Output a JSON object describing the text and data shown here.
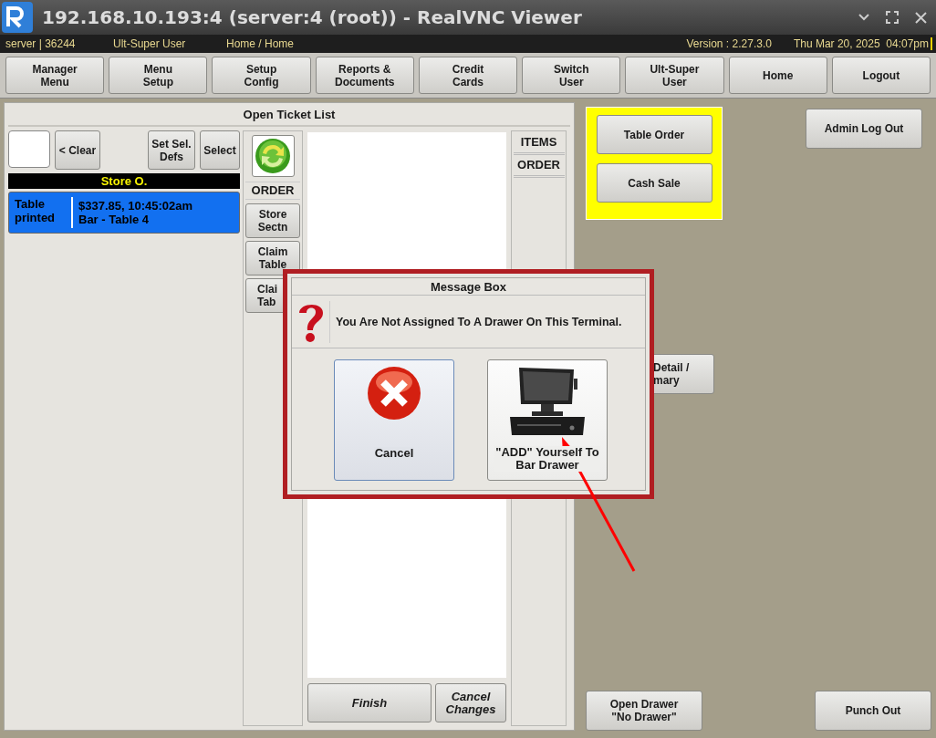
{
  "window": {
    "title": "192.168.10.193:4 (server:4 (root)) - RealVNC Viewer"
  },
  "status_bar": {
    "user": "server | 36244",
    "role": "Ult-Super User",
    "path": "Home / Home",
    "version": "Version : 2.27.3.0",
    "datetime": "Thu Mar 20, 2025  04:07pm"
  },
  "toolbar": [
    "Manager\nMenu",
    "Menu\nSetup",
    "Setup\nConfig",
    "Reports &\nDocuments",
    "Credit\nCards",
    "Switch\nUser",
    "Ult-Super\nUser",
    "Home",
    "Logout"
  ],
  "open_ticket_list": {
    "title": "Open Ticket List",
    "clear_button": "< Clear",
    "set_defaults_button": "Set Sel.\nDefs",
    "select_button": "Select",
    "section": "Store O.",
    "tickets": [
      {
        "status": "Table\nprinted",
        "summary": "$337.85, 10:45:02am",
        "location": "Bar - Table 4",
        "selected": true
      }
    ],
    "order_column": {
      "header": "ORDER",
      "buttons": [
        "Store\nSectn",
        "Claim\nTable",
        "Clai\nTab"
      ]
    },
    "items_tabs": [
      "ITEMS",
      "ORDER"
    ],
    "finish_button": "Finish",
    "cancel_changes_button": "Cancel\nChanges"
  },
  "right_panel": {
    "order_types": [
      "Table Order",
      "Cash Sale"
    ],
    "admin_button": "Admin Log Out",
    "detail_button": "Detail /\nmary",
    "open_drawer_button": "Open Drawer\n\"No Drawer\"",
    "punch_out_button": "Punch Out"
  },
  "message_box": {
    "title": "Message Box",
    "message": "You Are Not Assigned To A Drawer On This Terminal.",
    "buttons": [
      {
        "kind": "cancel",
        "label": "Cancel",
        "selected": true
      },
      {
        "kind": "drawer",
        "label": "\"ADD\" Yourself To\nBar Drawer",
        "selected": false
      }
    ]
  }
}
